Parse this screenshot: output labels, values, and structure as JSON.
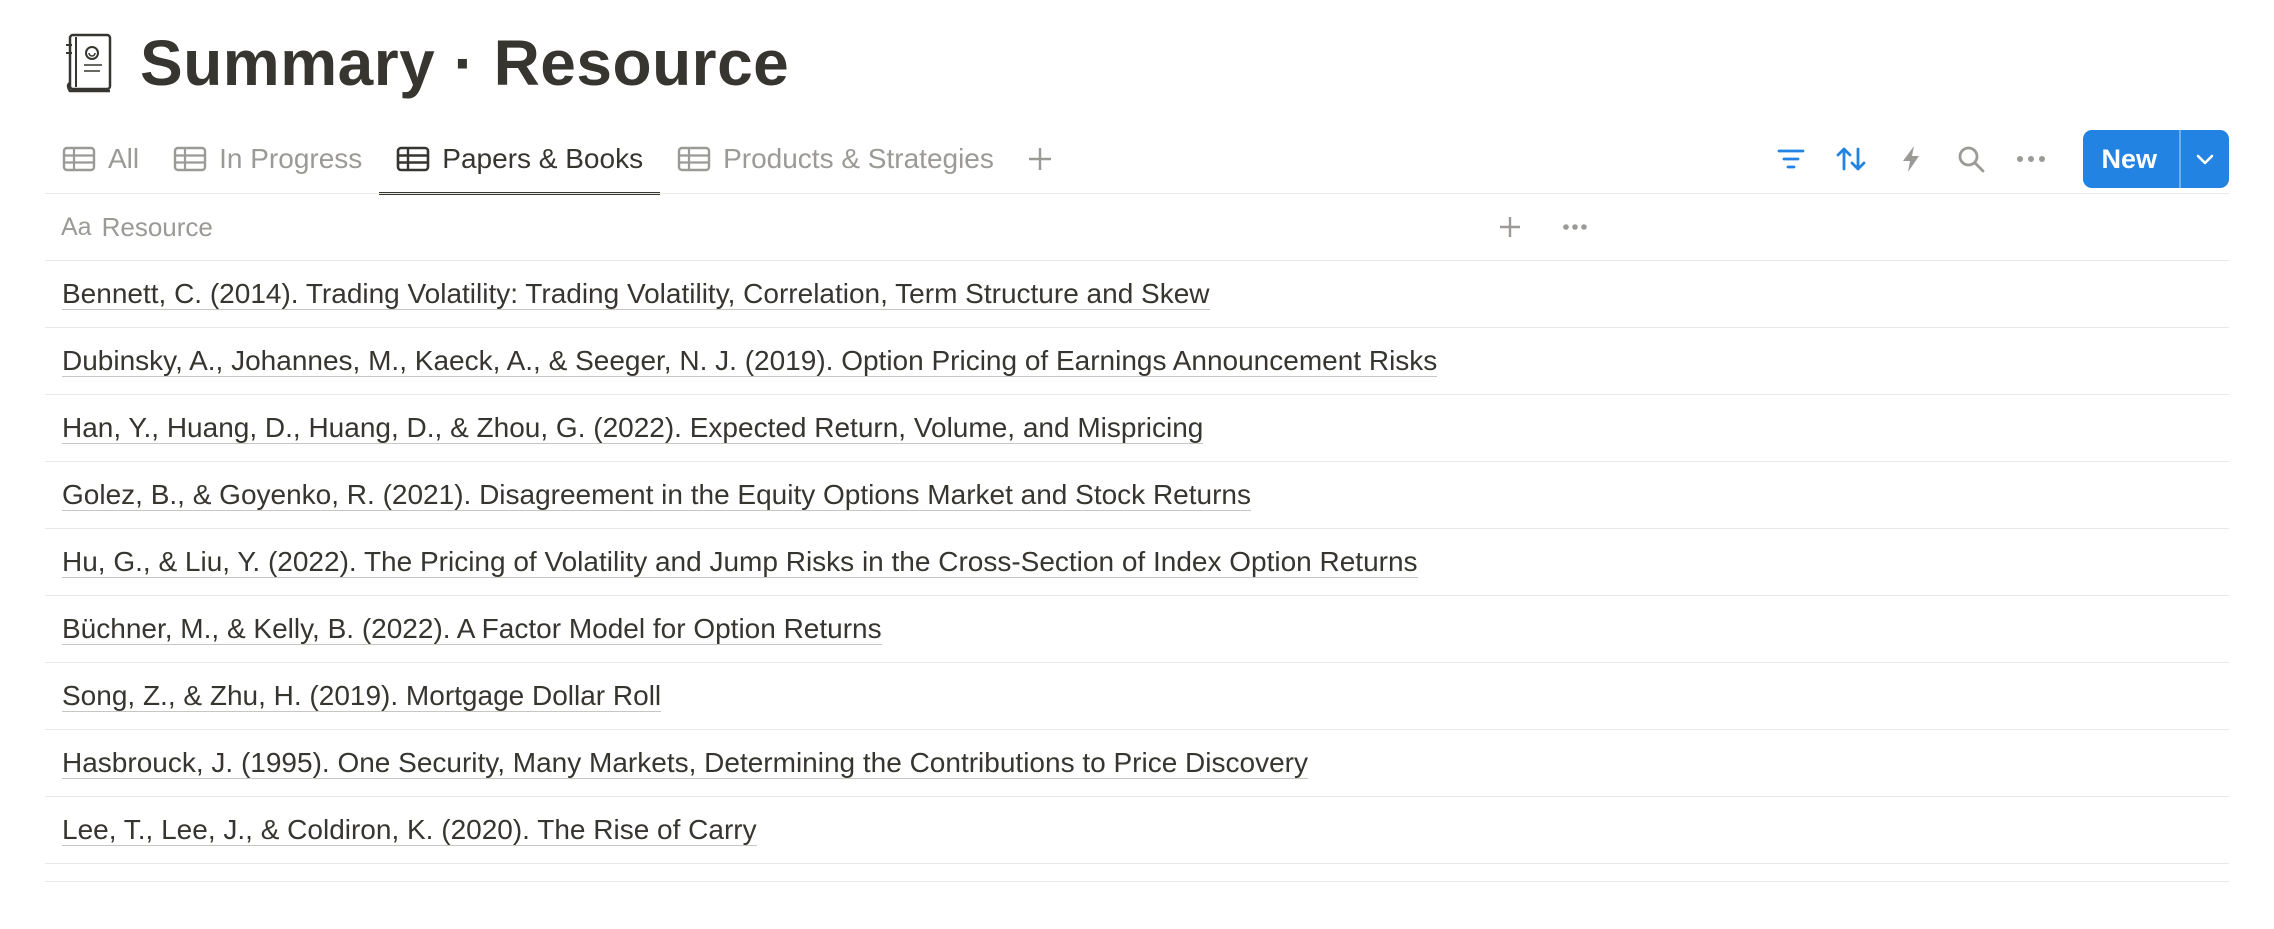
{
  "page": {
    "title": "Summary · Resource",
    "icon": "notebook-icon"
  },
  "tabs": [
    {
      "label": "All",
      "icon": "table-icon",
      "active": false
    },
    {
      "label": "In Progress",
      "icon": "table-icon",
      "active": false
    },
    {
      "label": "Papers & Books",
      "icon": "table-icon",
      "active": true
    },
    {
      "label": "Products & Strategies",
      "icon": "table-icon",
      "active": false
    }
  ],
  "toolbar": {
    "icons": [
      "filter-icon",
      "sort-icon",
      "automation-icon",
      "search-icon",
      "more-icon"
    ],
    "new_label": "New",
    "accent": "#2383e2"
  },
  "table": {
    "column": {
      "type_icon_text": "Aa",
      "label": "Resource"
    },
    "rows": [
      "Bennett, C. (2014). Trading Volatility: Trading Volatility, Correlation, Term Structure and Skew",
      "Dubinsky, A., Johannes, M., Kaeck, A., & Seeger, N. J. (2019). Option Pricing of Earnings Announcement Risks",
      "Han, Y., Huang, D., Huang, D., & Zhou, G. (2022). Expected Return, Volume, and Mispricing",
      "Golez, B., & Goyenko, R. (2021). Disagreement in the Equity Options Market and Stock Returns",
      "Hu, G., & Liu, Y. (2022). The Pricing of Volatility and Jump Risks in the Cross-Section of Index Option Returns",
      "Büchner, M., & Kelly, B. (2022). A Factor Model for Option Returns",
      "Song, Z., & Zhu, H. (2019). Mortgage Dollar Roll",
      "Hasbrouck, J. (1995). One Security, Many Markets, Determining the Contributions to Price Discovery",
      "Lee, T., Lee, J., & Coldiron, K. (2020). The Rise of Carry"
    ]
  }
}
